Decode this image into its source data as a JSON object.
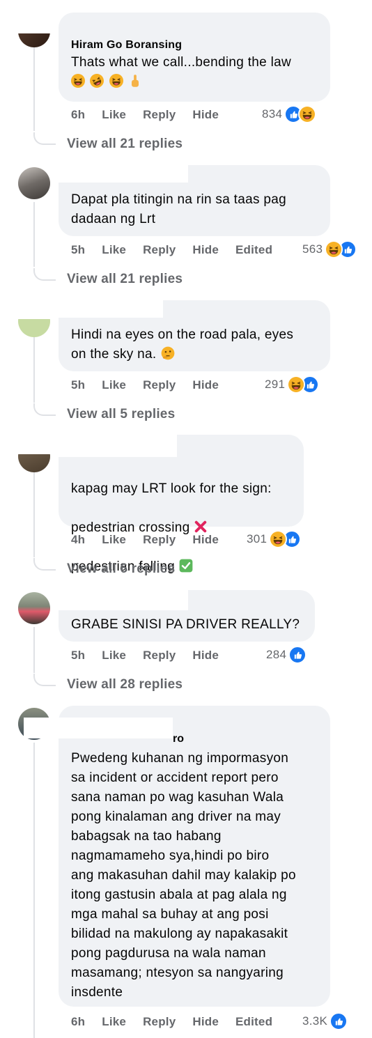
{
  "comments": [
    {
      "author": "Hiram Go Boransing",
      "text": "Thats what we call...bending the law",
      "time": "6h",
      "like": "Like",
      "reply": "Reply",
      "hide": "Hide",
      "edited": "",
      "reaction_count": "834",
      "reactions": [
        "like",
        "haha"
      ],
      "view_replies": "View all 21 replies"
    },
    {
      "author": "",
      "text": "Dapat pla titingin na rin sa taas pag\ndadaan ng Lrt",
      "time": "5h",
      "like": "Like",
      "reply": "Reply",
      "hide": "Hide",
      "edited": "Edited",
      "reaction_count": "563",
      "reactions": [
        "haha",
        "like"
      ],
      "view_replies": "View all 21 replies"
    },
    {
      "author": "",
      "text": "Hindi na eyes on the road pala, eyes\non the sky na.",
      "time": "5h",
      "like": "Like",
      "reply": "Reply",
      "hide": "Hide",
      "edited": "",
      "reaction_count": "291",
      "reactions": [
        "haha",
        "like"
      ],
      "view_replies": "View all 5 replies"
    },
    {
      "author": "",
      "text_lines": [
        "kapag may LRT look for the sign:",
        "pedestrian crossing",
        "pedestrian falling"
      ],
      "time": "4h",
      "like": "Like",
      "reply": "Reply",
      "hide": "Hide",
      "edited": "",
      "reaction_count": "301",
      "reactions": [
        "haha",
        "like"
      ],
      "view_replies": "View all 6 replies"
    },
    {
      "author": "",
      "text": "GRABE SINISI PA DRIVER REALLY?",
      "time": "5h",
      "like": "Like",
      "reply": "Reply",
      "hide": "Hide",
      "edited": "",
      "reaction_count": "284",
      "reactions": [
        "like"
      ],
      "view_replies": "View all 28 replies"
    },
    {
      "author_fragment": "ro",
      "text": "Pwedeng kuhanan ng impormasyon\nsa incident or accident report pero\nsana naman po wag kasuhan Wala\npong kinalaman ang driver na may\nbabagsak na tao habang\nnagmamameho sya,hindi po biro\nang makasuhan dahil may kalakip po\nitong gastusin abala at pag alala ng\nmga mahal sa buhay at ang posi\nbilidad na makulong ay napakasakit\npong pagdurusa na wala naman\nmasamang; ntesyon sa nangyaring\ninsdente",
      "time": "6h",
      "like": "Like",
      "reply": "Reply",
      "hide": "Hide",
      "edited": "Edited",
      "reaction_count": "3.3K",
      "reactions": [
        "like"
      ]
    }
  ],
  "colors": {
    "bubble": "#f0f2f5",
    "meta_text": "#65676b",
    "like_blue": "#1877f2",
    "haha_yellow": "#f7b125",
    "thread_line": "#dfe1e5"
  },
  "icons": {
    "like": "thumbs-up-icon",
    "haha": "laughing-face-icon",
    "cross": "red-cross-mark-icon",
    "check": "green-check-mark-icon",
    "thinking": "thinking-face-icon"
  }
}
